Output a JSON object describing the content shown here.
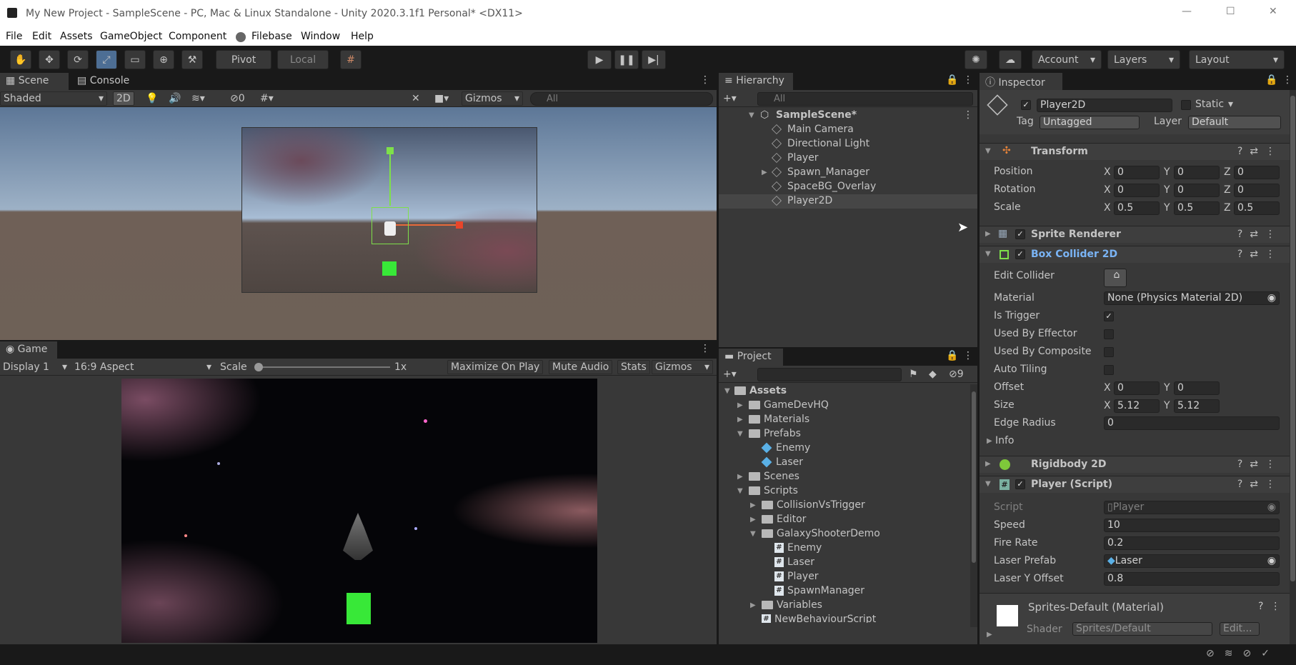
{
  "window": {
    "title": "My New Project - SampleScene - PC, Mac & Linux Standalone - Unity 2020.3.1f1 Personal* <DX11>",
    "minimize": "—",
    "maximize": "☐",
    "close": "✕"
  },
  "menu": [
    "File",
    "Edit",
    "Assets",
    "GameObject",
    "Component",
    "Filebase",
    "Window",
    "Help"
  ],
  "toolbar": {
    "pivot": "Pivot",
    "local": "Local",
    "account": "Account",
    "layers": "Layers",
    "layout": "Layout"
  },
  "scene": {
    "tab_scene": "Scene",
    "tab_console": "Console",
    "shading": "Shaded",
    "mode_2d": "2D",
    "hidden_count": "0",
    "gizmos": "Gizmos",
    "search_placeholder": "All"
  },
  "game": {
    "tab": "Game",
    "display": "Display 1",
    "aspect": "16:9 Aspect",
    "scale_label": "Scale",
    "scale_value": "1x",
    "maximize": "Maximize On Play",
    "mute": "Mute Audio",
    "stats": "Stats",
    "gizmos": "Gizmos"
  },
  "hierarchy": {
    "tab": "Hierarchy",
    "search_placeholder": "All",
    "scene": "SampleScene*",
    "items": [
      "Main Camera",
      "Directional Light",
      "Player",
      "Spawn_Manager",
      "SpaceBG_Overlay",
      "Player2D"
    ]
  },
  "project": {
    "tab": "Project",
    "hidden_count": "9",
    "root": "Assets",
    "items": [
      {
        "label": "GameDevHQ",
        "indent": 1,
        "type": "folder",
        "expand": "closed"
      },
      {
        "label": "Materials",
        "indent": 1,
        "type": "folder",
        "expand": "closed"
      },
      {
        "label": "Prefabs",
        "indent": 1,
        "type": "folder",
        "expand": "open"
      },
      {
        "label": "Enemy",
        "indent": 2,
        "type": "prefab",
        "expand": "none"
      },
      {
        "label": "Laser",
        "indent": 2,
        "type": "prefab",
        "expand": "none"
      },
      {
        "label": "Scenes",
        "indent": 1,
        "type": "folder",
        "expand": "closed"
      },
      {
        "label": "Scripts",
        "indent": 1,
        "type": "folder",
        "expand": "open"
      },
      {
        "label": "CollisionVsTrigger",
        "indent": 2,
        "type": "folder",
        "expand": "closed"
      },
      {
        "label": "Editor",
        "indent": 2,
        "type": "folder",
        "expand": "closed"
      },
      {
        "label": "GalaxyShooterDemo",
        "indent": 2,
        "type": "folder",
        "expand": "open"
      },
      {
        "label": "Enemy",
        "indent": 3,
        "type": "script",
        "expand": "none"
      },
      {
        "label": "Laser",
        "indent": 3,
        "type": "script",
        "expand": "none"
      },
      {
        "label": "Player",
        "indent": 3,
        "type": "script",
        "expand": "none"
      },
      {
        "label": "SpawnManager",
        "indent": 3,
        "type": "script",
        "expand": "none"
      },
      {
        "label": "Variables",
        "indent": 2,
        "type": "folder",
        "expand": "closed"
      },
      {
        "label": "NewBehaviourScript",
        "indent": 2,
        "type": "script",
        "expand": "none"
      }
    ]
  },
  "inspector": {
    "tab": "Inspector",
    "object_name": "Player2D",
    "static_label": "Static",
    "tag_label": "Tag",
    "tag_value": "Untagged",
    "layer_label": "Layer",
    "layer_value": "Default",
    "transform": {
      "title": "Transform",
      "position_label": "Position",
      "rotation_label": "Rotation",
      "scale_label": "Scale",
      "position": [
        "0",
        "0",
        "0"
      ],
      "rotation": [
        "0",
        "0",
        "0"
      ],
      "scale": [
        "0.5",
        "0.5",
        "0.5"
      ]
    },
    "axes": [
      "X",
      "Y",
      "Z"
    ],
    "sprite_renderer": "Sprite Renderer",
    "box_collider": {
      "title": "Box Collider 2D",
      "edit_collider": "Edit Collider",
      "material_label": "Material",
      "material_value": "None (Physics Material 2D)",
      "is_trigger": "Is Trigger",
      "used_by_effector": "Used By Effector",
      "used_by_composite": "Used By Composite",
      "auto_tiling": "Auto Tiling",
      "offset_label": "Offset",
      "offset": [
        "0",
        "0"
      ],
      "size_label": "Size",
      "size": [
        "5.12",
        "5.12"
      ],
      "edge_radius_label": "Edge Radius",
      "edge_radius": "0",
      "info": "Info"
    },
    "rigidbody": "Rigidbody 2D",
    "player_script": {
      "title": "Player (Script)",
      "script_label": "Script",
      "script_value": "Player",
      "speed_label": "Speed",
      "speed": "10",
      "fire_rate_label": "Fire Rate",
      "fire_rate": "0.2",
      "laser_prefab_label": "Laser Prefab",
      "laser_prefab": "Laser",
      "laser_offset_label": "Laser Y Offset",
      "laser_offset": "0.8"
    },
    "material": {
      "title": "Sprites-Default (Material)",
      "shader_label": "Shader",
      "shader_value": "Sprites/Default",
      "edit": "Edit..."
    }
  },
  "colors": {
    "accent": "#4d6e94",
    "link_blue": "#7ab4f5",
    "collider_green": "#38e838"
  }
}
